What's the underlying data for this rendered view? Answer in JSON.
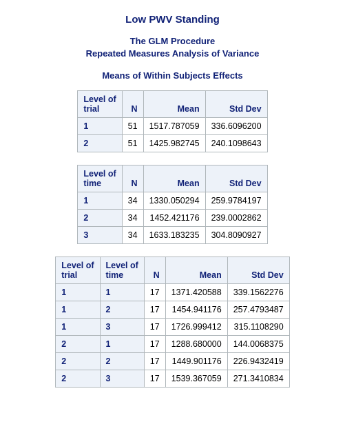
{
  "title": "Low PWV Standing",
  "subtitle1": "The GLM Procedure",
  "subtitle2": "Repeated Measures Analysis of Variance",
  "subhead": "Means of Within Subjects Effects",
  "headers": {
    "level_trial": "Level of\ntrial",
    "level_time": "Level of\ntime",
    "n": "N",
    "mean": "Mean",
    "std": "Std Dev"
  },
  "table1": {
    "rows": [
      {
        "trial": "1",
        "n": "51",
        "mean": "1517.787059",
        "std": "336.6096200"
      },
      {
        "trial": "2",
        "n": "51",
        "mean": "1425.982745",
        "std": "240.1098643"
      }
    ]
  },
  "table2": {
    "rows": [
      {
        "time": "1",
        "n": "34",
        "mean": "1330.050294",
        "std": "259.9784197"
      },
      {
        "time": "2",
        "n": "34",
        "mean": "1452.421176",
        "std": "239.0002862"
      },
      {
        "time": "3",
        "n": "34",
        "mean": "1633.183235",
        "std": "304.8090927"
      }
    ]
  },
  "table3": {
    "rows": [
      {
        "trial": "1",
        "time": "1",
        "n": "17",
        "mean": "1371.420588",
        "std": "339.1562276"
      },
      {
        "trial": "1",
        "time": "2",
        "n": "17",
        "mean": "1454.941176",
        "std": "257.4793487"
      },
      {
        "trial": "1",
        "time": "3",
        "n": "17",
        "mean": "1726.999412",
        "std": "315.1108290"
      },
      {
        "trial": "2",
        "time": "1",
        "n": "17",
        "mean": "1288.680000",
        "std": "144.0068375"
      },
      {
        "trial": "2",
        "time": "2",
        "n": "17",
        "mean": "1449.901176",
        "std": "226.9432419"
      },
      {
        "trial": "2",
        "time": "3",
        "n": "17",
        "mean": "1539.367059",
        "std": "271.3410834"
      }
    ]
  }
}
